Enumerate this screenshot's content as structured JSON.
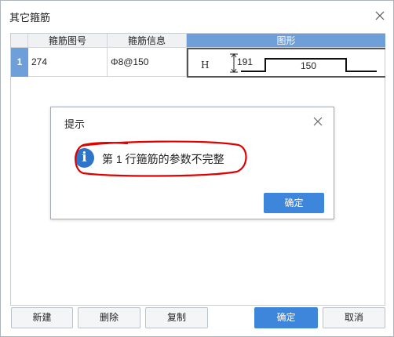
{
  "window": {
    "title": "其它箍筋"
  },
  "table": {
    "columns": [
      "箍筋图号",
      "箍筋信息",
      "图形"
    ],
    "rows": [
      {
        "index": "1",
        "shape_no": "274",
        "info": "Φ8@150",
        "shape": {
          "letter": "H",
          "height_label": "191",
          "width_label": "150"
        }
      }
    ]
  },
  "buttons": {
    "new": "新建",
    "delete": "删除",
    "copy": "复制",
    "ok": "确定",
    "cancel": "取消"
  },
  "dialog": {
    "title": "提示",
    "icon": "info-icon",
    "message": "第 1 行箍筋的参数不完整",
    "ok": "确定"
  },
  "colors": {
    "accent": "#3e86db",
    "selected_header": "#6f9fd9",
    "annotation": "#e00000"
  }
}
